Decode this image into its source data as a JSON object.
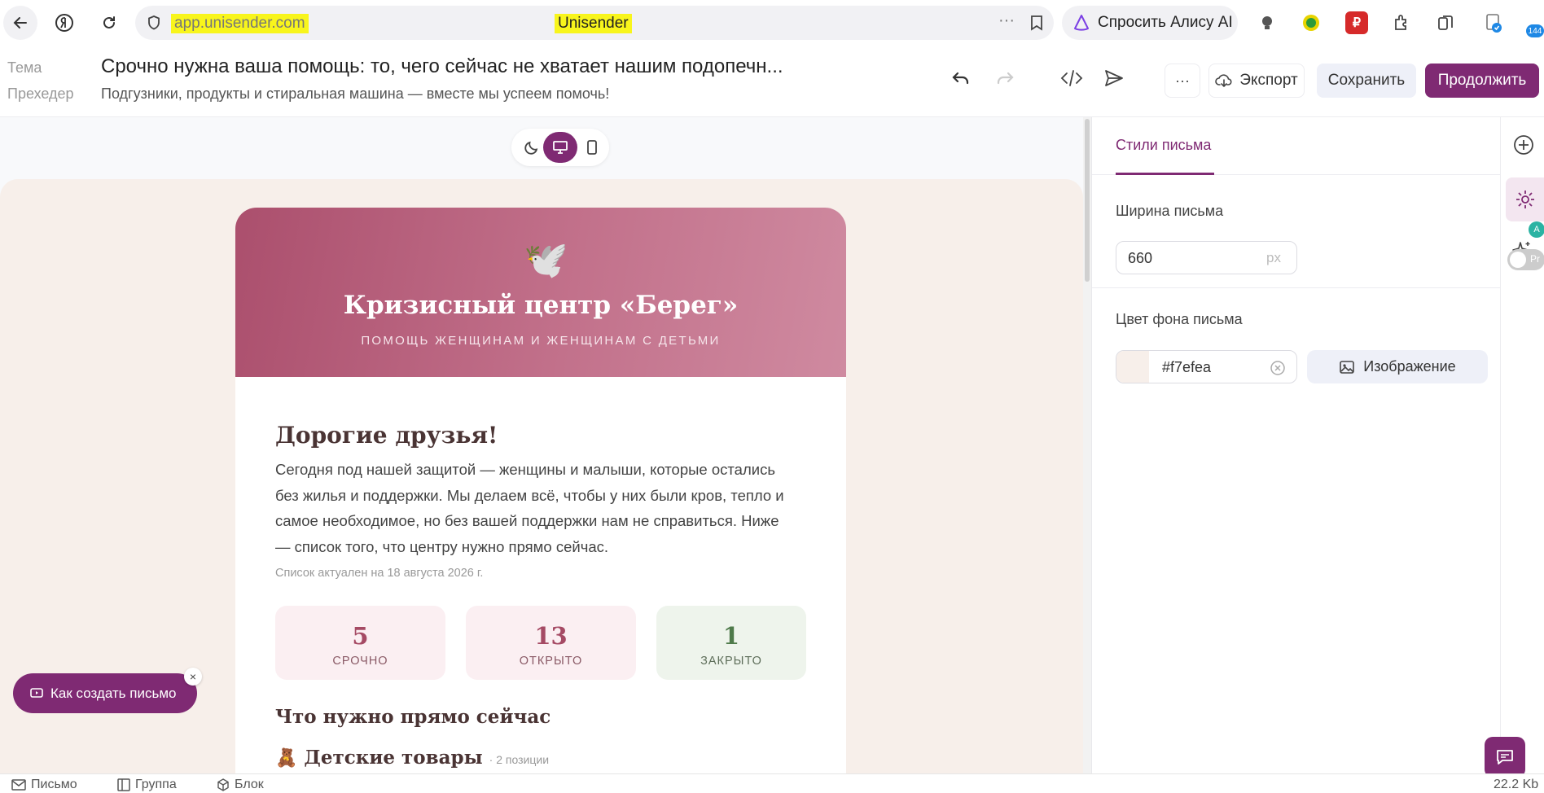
{
  "browser": {
    "url": "app.unisender.com",
    "page_title": "Unisender",
    "alice_label": "Спросить Алису AI",
    "extension_badge": "144"
  },
  "header": {
    "subject_label": "Тема",
    "subject_value": "Срочно нужна ваша помощь: то, чего сейчас не хватает нашим подопечн...",
    "preheader_label": "Прехедер",
    "preheader_value": "Подгузники, продукты и стиральная машина — вместе мы успеем помочь!",
    "more_label": "···",
    "export_label": "Экспорт",
    "save_label": "Сохранить",
    "continue_label": "Продолжить"
  },
  "email": {
    "org_title": "Кризисный центр «Берег»",
    "org_subtitle": "ПОМОЩЬ ЖЕНЩИНАМ И ЖЕНЩИНАМ С ДЕТЬМИ",
    "greeting": "Дорогие друзья!",
    "body": "Сегодня под нашей защитой — женщины и малыши, которые остались без жилья и поддержки. Мы делаем всё, чтобы у них были кров, тепло и самое необходимое, но без вашей поддержки нам не справиться. Ниже — список того, что центру нужно прямо сейчас.",
    "updated": "Список актуален на 18 августа 2026 г.",
    "stats": [
      {
        "value": "5",
        "label": "СРОЧНО"
      },
      {
        "value": "13",
        "label": "ОТКРЫТО"
      },
      {
        "value": "1",
        "label": "ЗАКРЫТО"
      }
    ],
    "section_title": "Что нужно прямо сейчас",
    "category_name": "Детские товары",
    "category_count": "· 2 позиции"
  },
  "help": {
    "label": "Как создать письмо",
    "close": "×"
  },
  "panel": {
    "tab_label": "Стили письма",
    "width_label": "Ширина письма",
    "width_value": "660",
    "width_unit": "px",
    "bg_label": "Цвет фона письма",
    "bg_value": "#f7efea",
    "image_label": "Изображение"
  },
  "rail": {
    "toggle_label": "Pr"
  },
  "statusbar": {
    "tab1": "Письмо",
    "tab2": "Группа",
    "tab3": "Блок",
    "size": "22.2 Kb"
  },
  "colors": {
    "accent": "#7f2a73",
    "email_bg": "#f7efea",
    "hero": "#ba6580",
    "highlight": "#f8f51c"
  }
}
